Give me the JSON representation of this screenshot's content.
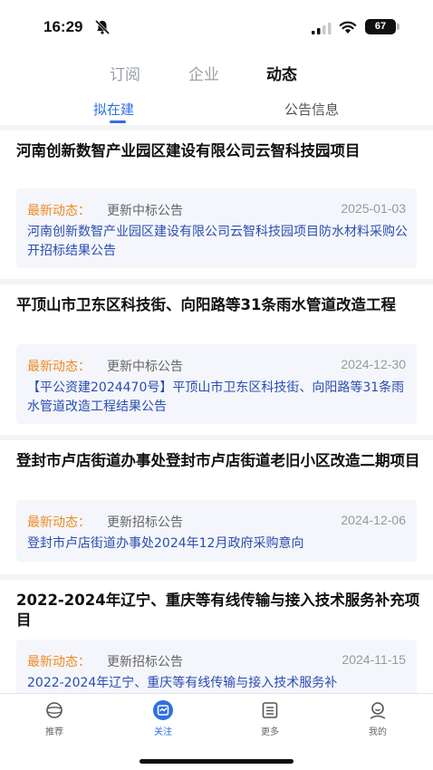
{
  "status_bar": {
    "time": "16:29",
    "battery": "67"
  },
  "top_tabs": [
    {
      "label": "订阅"
    },
    {
      "label": "企业"
    },
    {
      "label": "动态"
    }
  ],
  "sub_tabs": [
    {
      "label": "拟在建"
    },
    {
      "label": "公告信息"
    }
  ],
  "items": [
    {
      "title": "河南创新数智产业园区建设有限公司云智科技园项目",
      "update_label": "最新动态：",
      "update_type": "更新中标公告",
      "date": "2025-01-03",
      "description": "河南创新数智产业园区建设有限公司云智科技园项目防水材料采购公开招标结果公告"
    },
    {
      "title": "平顶山市卫东区科技街、向阳路等31条雨水管道改造工程",
      "update_label": "最新动态：",
      "update_type": "更新中标公告",
      "date": "2024-12-30",
      "description": "【平公资建2024470号】平顶山市卫东区科技街、向阳路等31条雨水管道改造工程结果公告"
    },
    {
      "title": "登封市卢店街道办事处登封市卢店街道老旧小区改造二期项目",
      "update_label": "最新动态：",
      "update_type": "更新招标公告",
      "date": "2024-12-06",
      "description": "登封市卢店街道办事处2024年12月政府采购意向"
    },
    {
      "title": "2022-2024年辽宁、重庆等有线传输与接入技术服务补充项目",
      "update_label": "最新动态：",
      "update_type": "更新招标公告",
      "date": "2024-11-15",
      "description": "2022-2024年辽宁、重庆等有线传输与接入技术服务补"
    }
  ],
  "bottom_nav": [
    {
      "label": "推荐",
      "icon": "planet-icon"
    },
    {
      "label": "关注",
      "icon": "follow-icon"
    },
    {
      "label": "更多",
      "icon": "list-icon"
    },
    {
      "label": "我的",
      "icon": "profile-icon"
    }
  ],
  "colors": {
    "accent": "#2f6fe4",
    "update_label": "#f08a24",
    "description": "#2b4db0"
  }
}
